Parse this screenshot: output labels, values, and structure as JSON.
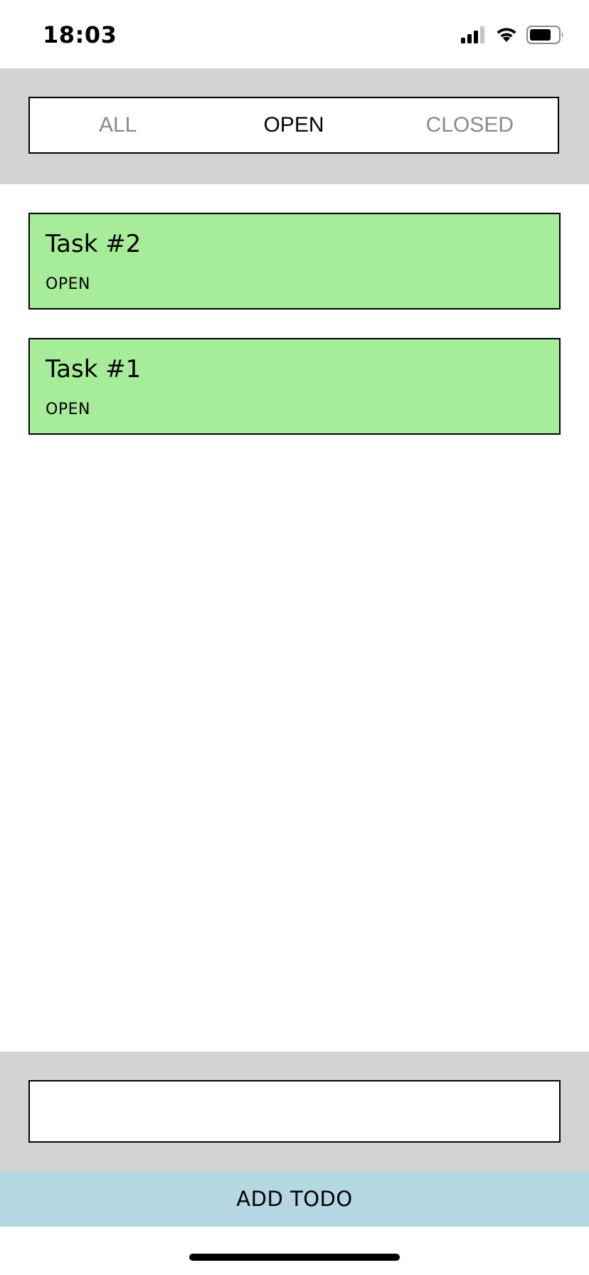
{
  "status_bar": {
    "time": "18:03",
    "icons": [
      "cellular-signal-icon",
      "wifi-icon",
      "battery-icon"
    ]
  },
  "filter": {
    "tabs": [
      {
        "label": "ALL",
        "active": false
      },
      {
        "label": "OPEN",
        "active": true
      },
      {
        "label": "CLOSED",
        "active": false
      }
    ]
  },
  "tasks": [
    {
      "title": "Task #2",
      "status": "OPEN"
    },
    {
      "title": "Task #1",
      "status": "OPEN"
    }
  ],
  "input": {
    "value": "",
    "placeholder": ""
  },
  "add_button": {
    "label": "ADD TODO"
  },
  "colors": {
    "header_bg": "#d3d3d3",
    "task_bg": "#a6ec99",
    "add_button_bg": "#b4d7e2",
    "inactive_tab_text": "#8a8a8a"
  }
}
